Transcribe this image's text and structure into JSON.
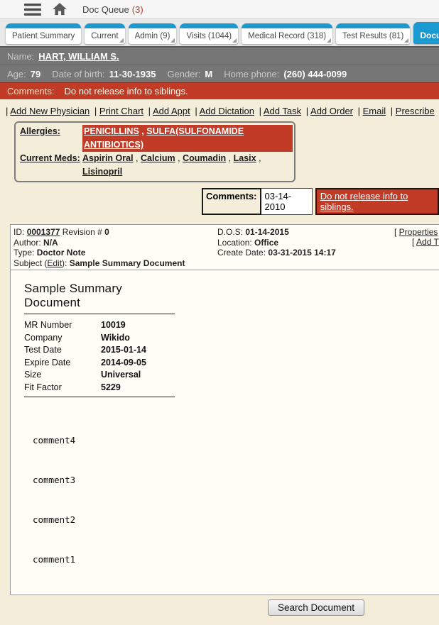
{
  "colors": {
    "tab_blue": "#1b9ad2",
    "alert_red": "#c23b27",
    "bar_gray": "#767676",
    "page_beige": "#f3edda"
  },
  "topbar": {
    "title": "Doc Queue",
    "count": "(3)"
  },
  "tabs": [
    {
      "label": "Patient Summary"
    },
    {
      "label": "Current",
      "dropdown": true
    },
    {
      "label": "Admin (9)",
      "dropdown": true
    },
    {
      "label": "Visits (1044)",
      "dropdown": true
    },
    {
      "label": "Medical Record (318)",
      "dropdown": true
    },
    {
      "label": "Test Results (81)",
      "dropdown": true
    },
    {
      "label": "Document S",
      "active": true
    }
  ],
  "patient": {
    "name_label": "Name:",
    "name": "HART, WILLIAM S.",
    "age_label": "Age:",
    "age": "79",
    "dob_label": "Date of birth:",
    "dob": "11-30-1935",
    "gender_label": "Gender:",
    "gender": "M",
    "phone_label": "Home phone:",
    "phone": "(260) 444-0099",
    "comments_label": "Comments:",
    "comments": "Do not release info to siblings."
  },
  "action_links": [
    "Add New Physician",
    "Print Chart",
    "Add Appt",
    "Add Dictation",
    "Add Task",
    "Add Order",
    "Email",
    "Prescribe"
  ],
  "allergy_box": {
    "allergies_label": "Allergies:",
    "allergies": [
      "PENICILLINS",
      "SULFA(SULFONAMIDE ANTIBIOTICS)"
    ],
    "meds_label": "Current Meds:",
    "meds": [
      "Aspirin Oral",
      "Calcium",
      "Coumadin",
      "Lasix",
      "Lisinopril"
    ]
  },
  "comment_box": {
    "label": "Comments:",
    "date": "03-14-2010",
    "text": "Do not release info to siblings."
  },
  "document": {
    "id_label": "ID:",
    "id": "0001377",
    "revision_label": "Revision #",
    "revision": "0",
    "dos_label": "D.O.S:",
    "dos": "01-14-2015",
    "properties_link": "Properties",
    "author_label": "Author:",
    "author": "N/A",
    "location_label": "Location:",
    "location": "Office",
    "add_partial_link": "Add T",
    "type_label": "Type:",
    "type": "Doctor Note",
    "create_label": "Create Date:",
    "create": "03-31-2015 14:17",
    "subject_label": "Subject (",
    "edit_link": "Edit",
    "subject_close": "):",
    "subject": "Sample Summary Document"
  },
  "doc_content": {
    "title": "Sample Summary Document",
    "fields": [
      {
        "label": "MR Number",
        "value": "10019"
      },
      {
        "label": "Company",
        "value": "Wikido"
      },
      {
        "label": "Test Date",
        "value": "2015-01-14"
      },
      {
        "label": "Expire Date",
        "value": "2014-09-05"
      },
      {
        "label": "Size",
        "value": "Universal"
      },
      {
        "label": "Fit Factor",
        "value": "5229"
      }
    ],
    "comments": [
      "comment4",
      "comment3",
      "comment2",
      "comment1"
    ]
  },
  "footer": {
    "search_button": "Search Document"
  }
}
